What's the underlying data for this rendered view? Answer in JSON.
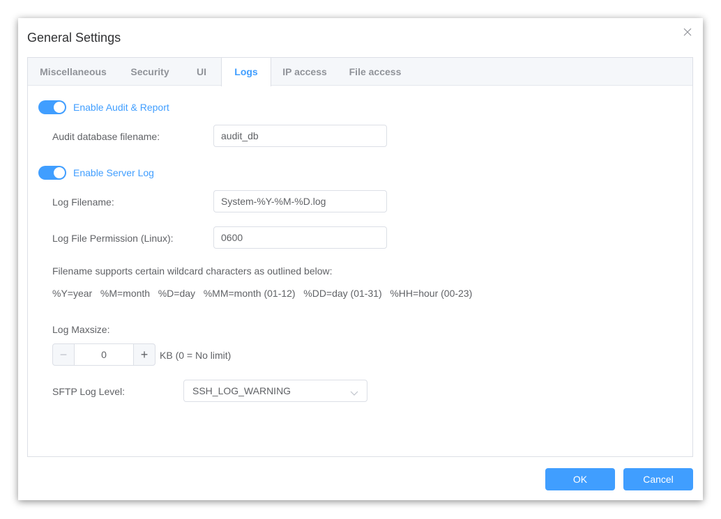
{
  "dialog": {
    "title": "General Settings"
  },
  "tabs": [
    {
      "label": "Miscellaneous",
      "active": false
    },
    {
      "label": "Security",
      "active": false
    },
    {
      "label": "UI",
      "active": false
    },
    {
      "label": "Logs",
      "active": true
    },
    {
      "label": "IP access",
      "active": false
    },
    {
      "label": "File access",
      "active": false
    }
  ],
  "logs": {
    "audit_toggle": {
      "label": "Enable Audit & Report",
      "on": true
    },
    "audit_db_label": "Audit database filename:",
    "audit_db_value": "audit_db",
    "server_log_toggle": {
      "label": "Enable Server Log",
      "on": true
    },
    "log_filename_label": "Log Filename:",
    "log_filename_value": "System-%Y-%M-%D.log",
    "log_permission_label": "Log File Permission (Linux):",
    "log_permission_value": "0600",
    "wildcard_note": "Filename supports certain wildcard characters as outlined below:",
    "wildcards": "%Y=year   %M=month   %D=day   %MM=month (01-12)   %DD=day (01-31)   %HH=hour (00-23)",
    "maxsize_label": "Log Maxsize:",
    "maxsize_value": "0",
    "maxsize_minus": "−",
    "maxsize_plus": "+",
    "maxsize_unit": "KB (0 = No limit)",
    "sftp_level_label": "SFTP Log Level:",
    "sftp_level_value": "SSH_LOG_WARNING"
  },
  "footer": {
    "ok_label": "OK",
    "cancel_label": "Cancel"
  },
  "colors": {
    "accent": "#409eff",
    "tab_inactive": "#909399",
    "text": "#606266"
  },
  "icons": {
    "close": "close-icon",
    "chevron": "chevron-down-icon"
  }
}
